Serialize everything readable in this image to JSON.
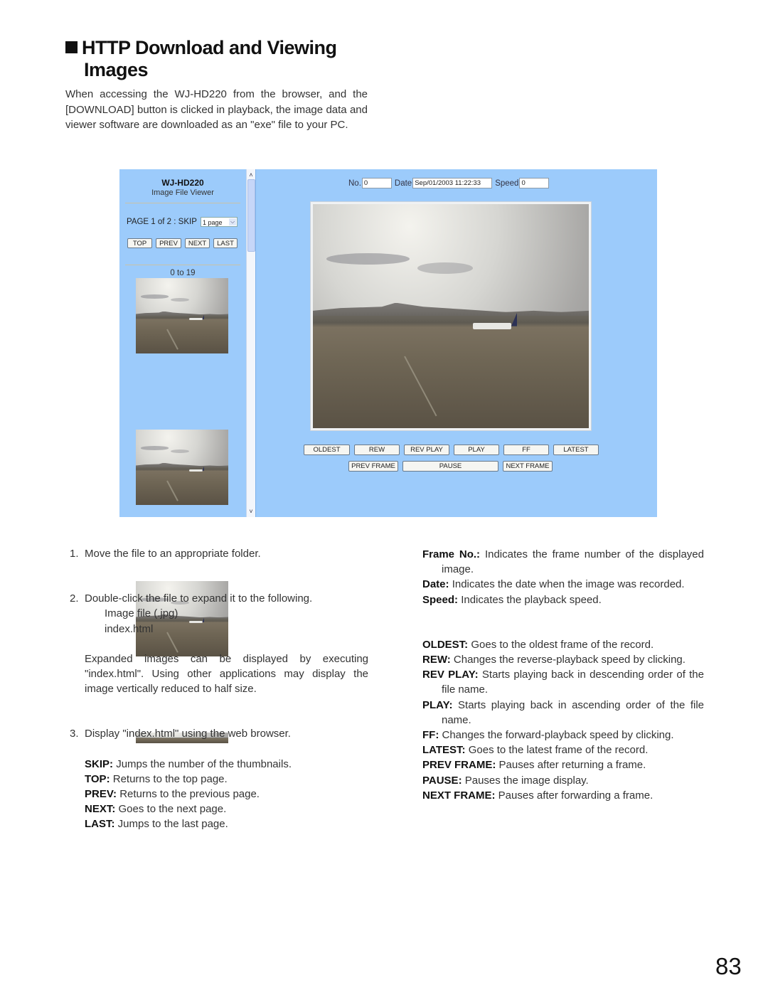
{
  "heading": {
    "marker_icon": "black-square",
    "line1": "HTTP Download and Viewing",
    "line2": "Images"
  },
  "intro": "When accessing the WJ-HD220 from the browser, and the [DOWNLOAD] button is clicked in playback, the image data and viewer software are downloaded as an \"exe\" file to your PC.",
  "viewer": {
    "background_color": "#9ccbfb",
    "left_pane": {
      "title": "WJ-HD220",
      "subtitle": "Image File Viewer",
      "page_info": "PAGE 1 of 2 : SKIP",
      "skip_select_value": "1 page",
      "nav_buttons": [
        "TOP",
        "PREV",
        "NEXT",
        "LAST"
      ],
      "range_label": "0 to 19",
      "thumbnail_count_visible": 4
    },
    "scrollbar": {
      "up_icon": "chevron-up",
      "down_icon": "chevron-down"
    },
    "right_pane": {
      "no_label": "No.",
      "no_value": "0",
      "date_label": "Date",
      "date_value": "Sep/01/2003 11:22:33",
      "speed_label": "Speed",
      "speed_value": "0",
      "controls_row1": [
        "OLDEST",
        "REW",
        "REV PLAY",
        "PLAY",
        "FF",
        "LATEST"
      ],
      "controls_row2": [
        "PREV FRAME",
        "PAUSE",
        "NEXT FRAME"
      ]
    }
  },
  "steps": {
    "step1": {
      "num": "1.",
      "text": "Move the file to an appropriate folder."
    },
    "step2": {
      "num": "2.",
      "text": "Double-click the file to expand it to the following.",
      "files": [
        "Image file (.jpg)",
        "index.html"
      ],
      "note": "Expanded images can be displayed by executing \"index.html\". Using other applications may display the image vertically reduced to half size."
    },
    "step3": {
      "num": "3.",
      "text": "Display \"index.html\" using the web browser.",
      "definitions": [
        {
          "term": "SKIP:",
          "desc": "Jumps the number of the thumbnails."
        },
        {
          "term": "TOP:",
          "desc": "Returns to the top page."
        },
        {
          "term": "PREV:",
          "desc": "Returns to the previous page."
        },
        {
          "term": "NEXT:",
          "desc": "Goes to the next page."
        },
        {
          "term": "LAST:",
          "desc": "Jumps to the last page."
        }
      ]
    }
  },
  "right_column": {
    "fields": [
      {
        "term": "Frame No.:",
        "desc": "Indicates the frame number of the displayed image."
      },
      {
        "term": "Date:",
        "desc": "Indicates the date when the image was recorded."
      },
      {
        "term": "Speed:",
        "desc": "Indicates the playback speed."
      }
    ],
    "controls": [
      {
        "term": "OLDEST:",
        "desc": "Goes to the oldest frame of the record."
      },
      {
        "term": "REW:",
        "desc": "Changes the reverse-playback speed by clicking."
      },
      {
        "term": "REV PLAY:",
        "desc": "Starts playing back in descending order of the file name."
      },
      {
        "term": "PLAY:",
        "desc": "Starts playing back in ascending order of the file name."
      },
      {
        "term": "FF:",
        "desc": "Changes the forward-playback speed by clicking."
      },
      {
        "term": "LATEST:",
        "desc": "Goes to the latest frame of the record."
      },
      {
        "term": "PREV FRAME:",
        "desc": "Pauses after returning a frame."
      },
      {
        "term": "PAUSE:",
        "desc": "Pauses the image display."
      },
      {
        "term": "NEXT FRAME:",
        "desc": "Pauses after forwarding a frame."
      }
    ]
  },
  "page_number": "83"
}
